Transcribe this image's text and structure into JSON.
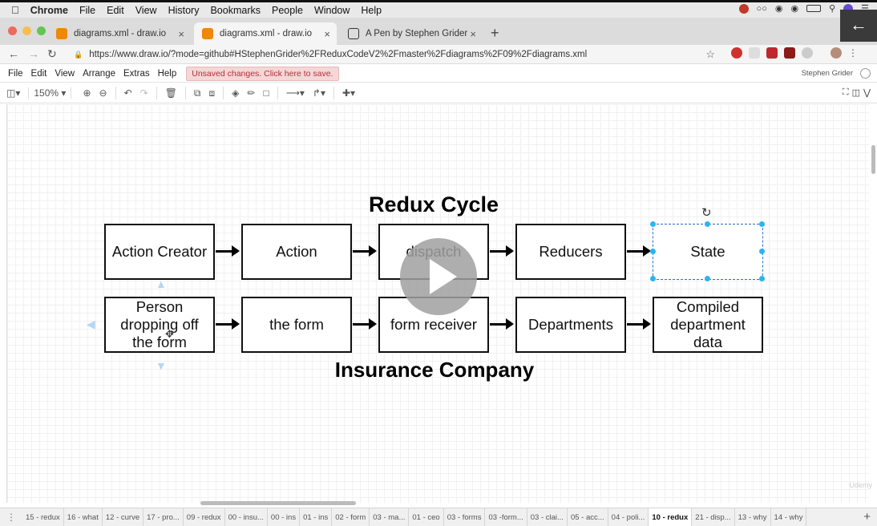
{
  "macos": {
    "app_name": "Chrome",
    "menu_items": [
      "File",
      "Edit",
      "View",
      "History",
      "Bookmarks",
      "People",
      "Window",
      "Help"
    ]
  },
  "browser": {
    "tabs": [
      {
        "title": "diagrams.xml - draw.io",
        "active": false
      },
      {
        "title": "diagrams.xml - draw.io",
        "active": true
      },
      {
        "title": "A Pen by Stephen Grider",
        "active": false
      }
    ],
    "url": "https://www.draw.io/?mode=github#HStephenGrider%2FReduxCodeV2%2Fmaster%2Fdiagrams%2F09%2Fdiagrams.xml"
  },
  "drawio": {
    "menu_items": [
      "File",
      "Edit",
      "View",
      "Arrange",
      "Extras",
      "Help"
    ],
    "unsaved_notice": "Unsaved changes. Click here to save.",
    "user_name": "Stephen Grider",
    "zoom": "150%"
  },
  "diagram": {
    "top_title": "Redux Cycle",
    "bottom_title": "Insurance Company",
    "top_row": [
      "Action Creator",
      "Action",
      "dispatch",
      "Reducers",
      "State"
    ],
    "bottom_row": [
      "Person dropping off the form",
      "the form",
      "form receiver",
      "Departments",
      "Compiled department data"
    ]
  },
  "page_tabs": [
    "15 - redux",
    "16 - what",
    "12 - curve",
    "17 - pro...",
    "09 - redux",
    "00 - insu...",
    "00 - ins",
    "01 - ins",
    "02 - form",
    "03 - ma...",
    "01 - ceo",
    "03 - forms",
    "03 -form...",
    "03 - clai...",
    "05 - acc...",
    "04 - poli...",
    "10 - redux",
    "21 - disp...",
    "13 - why",
    "14 - why"
  ],
  "active_page_tab": "10 - redux",
  "watermark": "Udemy",
  "colors": {
    "selection": "#2a70c9",
    "handle": "#29b6f2",
    "unsaved_bg": "#f4d7d7",
    "unsaved_text": "#b3303a"
  }
}
